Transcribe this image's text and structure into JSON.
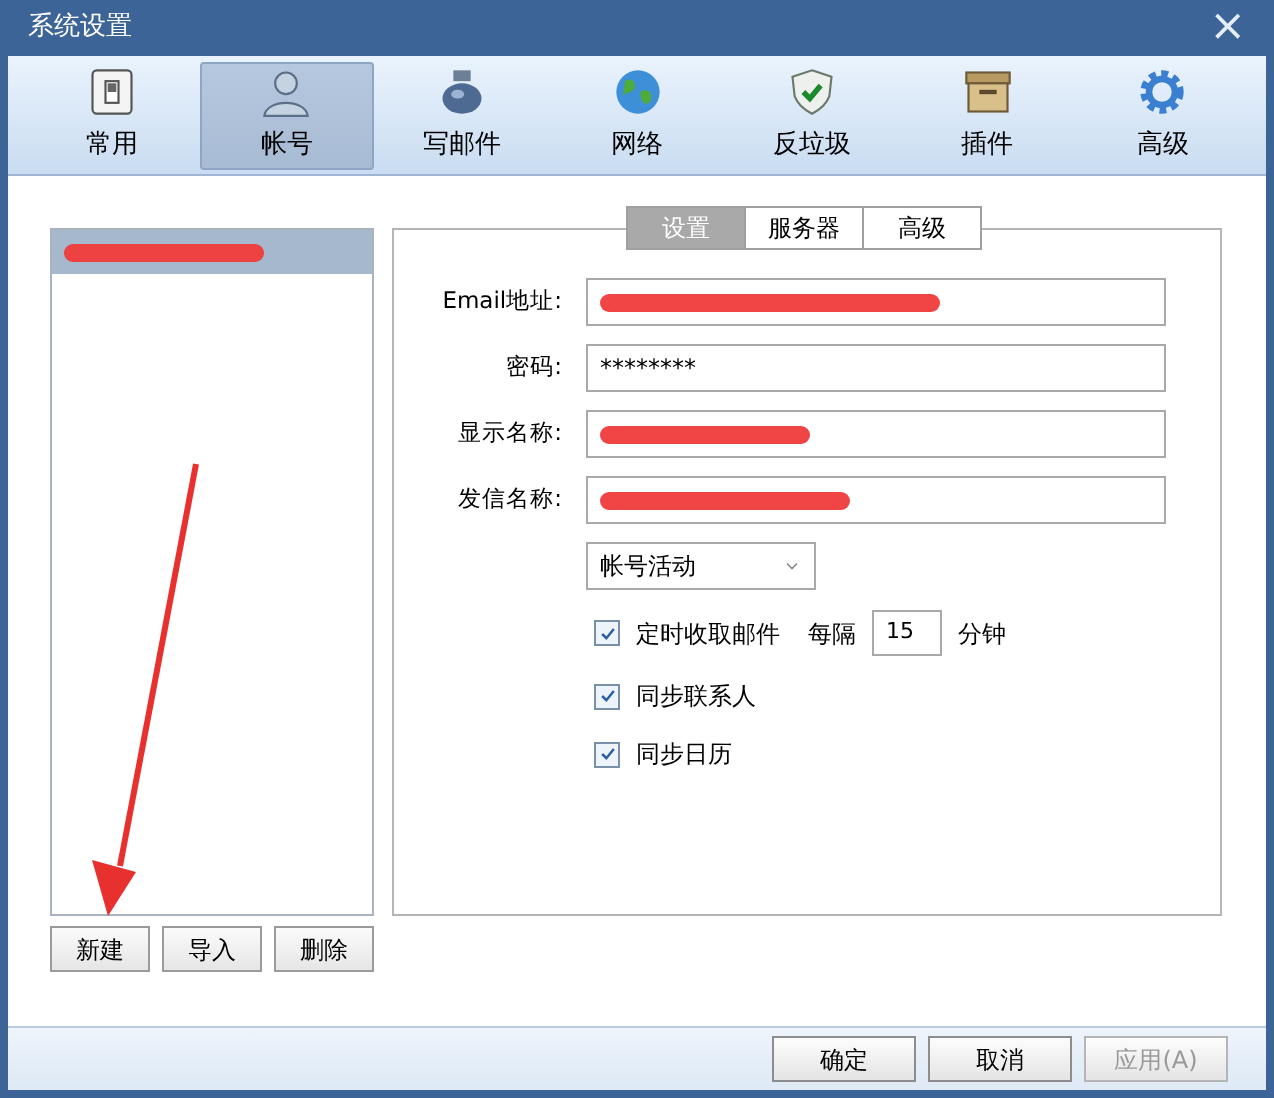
{
  "window": {
    "title": "系统设置",
    "close": "×"
  },
  "toolbar": [
    {
      "label": "常用",
      "kind": "switch",
      "selected": false
    },
    {
      "label": "帐号",
      "kind": "person",
      "selected": true
    },
    {
      "label": "写邮件",
      "kind": "ink",
      "selected": false
    },
    {
      "label": "网络",
      "kind": "globe",
      "selected": false
    },
    {
      "label": "反垃圾",
      "kind": "shield",
      "selected": false
    },
    {
      "label": "插件",
      "kind": "box",
      "selected": false
    },
    {
      "label": "高级",
      "kind": "gear",
      "selected": false
    }
  ],
  "account_list": {
    "items": [
      {
        "selected": true,
        "redacted": true
      }
    ],
    "buttons": [
      "新建",
      "导入",
      "删除"
    ]
  },
  "tabs": [
    {
      "label": "设置",
      "selected": true
    },
    {
      "label": "服务器",
      "selected": false
    },
    {
      "label": "高级",
      "selected": false
    }
  ],
  "fields": [
    {
      "label": "Email地址:",
      "redacted": true
    },
    {
      "label": "密码:",
      "value": "********",
      "redacted": false
    },
    {
      "label": "显示名称:",
      "redacted": true
    },
    {
      "label": "发信名称:",
      "redacted": true
    }
  ],
  "status_select": {
    "value": "帐号活动"
  },
  "options": [
    {
      "label": "定时收取邮件",
      "checked": true,
      "interval": {
        "prefix": "每隔",
        "value": "15",
        "suffix": "分钟"
      }
    },
    {
      "label": "同步联系人",
      "checked": true
    },
    {
      "label": "同步日历",
      "checked": true
    }
  ],
  "annotation": {
    "kind": "arrow"
  },
  "footer_buttons": [
    {
      "label": "确定",
      "disabled": false
    },
    {
      "label": "取消",
      "disabled": false
    },
    {
      "label": "应用(A)",
      "disabled": true
    }
  ]
}
